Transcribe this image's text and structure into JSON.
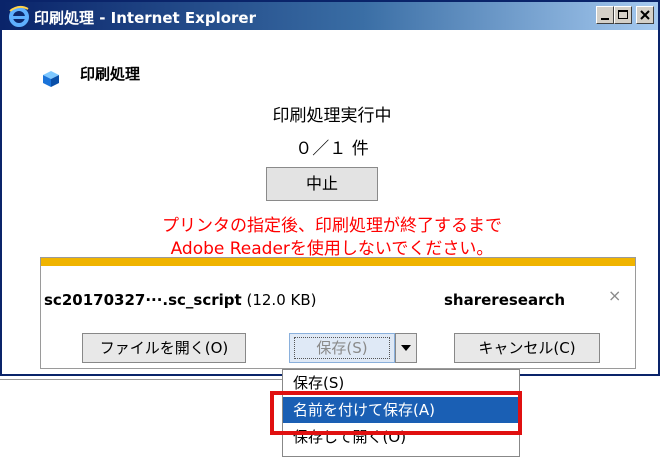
{
  "window": {
    "title": "印刷処理 - Internet Explorer",
    "controls": [
      "minimize-icon",
      "maximize-icon",
      "close-icon"
    ]
  },
  "header": {
    "label": "印刷処理"
  },
  "status": {
    "running": "印刷処理実行中",
    "count": "０／１ 件"
  },
  "abort_button": "中止",
  "warning": {
    "line1": "プリンタの指定後、印刷処理が終了するまで",
    "line2": "Adobe Readerを使用しないでください。"
  },
  "download_bar": {
    "filename": "sc20170327···.sc_script",
    "size": "(12.0 KB)",
    "site": "shareresearch",
    "close": "×",
    "buttons": {
      "open": "ファイルを開く(O)",
      "save": "保存(S)",
      "cancel": "キャンセル(C)"
    }
  },
  "save_menu": {
    "items": [
      "保存(S)",
      "名前を付けて保存(A)",
      "保存して開く(O)"
    ],
    "selected_index": 1
  },
  "colors": {
    "warning": "#ff0000",
    "accent_bar": "#f0b400",
    "highlight_box": "#e01010",
    "menu_selected": "#1a5fb4"
  }
}
